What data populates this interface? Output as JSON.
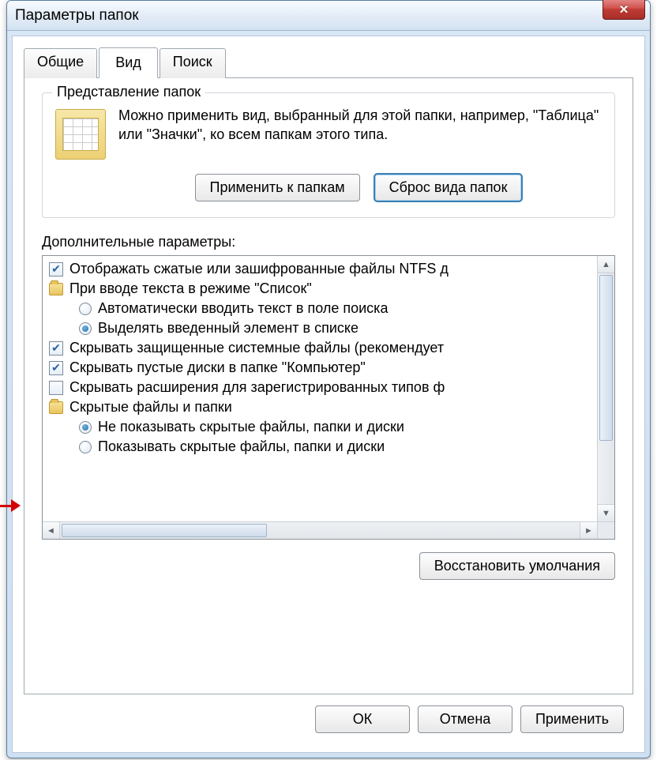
{
  "window": {
    "title": "Параметры папок"
  },
  "tabs": {
    "general": "Общие",
    "view": "Вид",
    "search": "Поиск"
  },
  "folderViews": {
    "legend": "Представление папок",
    "description": "Можно применить вид, выбранный для этой папки, например, \"Таблица\" или \"Значки\", ко всем папкам этого типа.",
    "apply_btn": "Применить к папкам",
    "reset_btn": "Сброс вида папок"
  },
  "advanced": {
    "label": "Дополнительные параметры:",
    "items": [
      {
        "type": "checkbox",
        "checked": true,
        "text": "Отображать сжатые или зашифрованные файлы NTFS д"
      },
      {
        "type": "folder",
        "text": "При вводе текста в режиме \"Список\""
      },
      {
        "type": "radio",
        "selected": false,
        "indent": true,
        "text": "Автоматически вводить текст в поле поиска"
      },
      {
        "type": "radio",
        "selected": true,
        "indent": true,
        "text": "Выделять введенный элемент в списке"
      },
      {
        "type": "checkbox",
        "checked": true,
        "text": "Скрывать защищенные системные файлы (рекомендует"
      },
      {
        "type": "checkbox",
        "checked": true,
        "text": "Скрывать пустые диски в папке \"Компьютер\""
      },
      {
        "type": "checkbox",
        "checked": false,
        "text": "Скрывать расширения для зарегистрированных типов ф"
      },
      {
        "type": "folder",
        "text": "Скрытые файлы и папки"
      },
      {
        "type": "radio",
        "selected": true,
        "indent": true,
        "text": "Не показывать скрытые файлы, папки и диски"
      },
      {
        "type": "radio",
        "selected": false,
        "indent": true,
        "text": "Показывать скрытые файлы, папки и диски"
      }
    ],
    "restore_btn": "Восстановить умолчания"
  },
  "buttons": {
    "ok": "ОК",
    "cancel": "Отмена",
    "apply": "Применить"
  }
}
